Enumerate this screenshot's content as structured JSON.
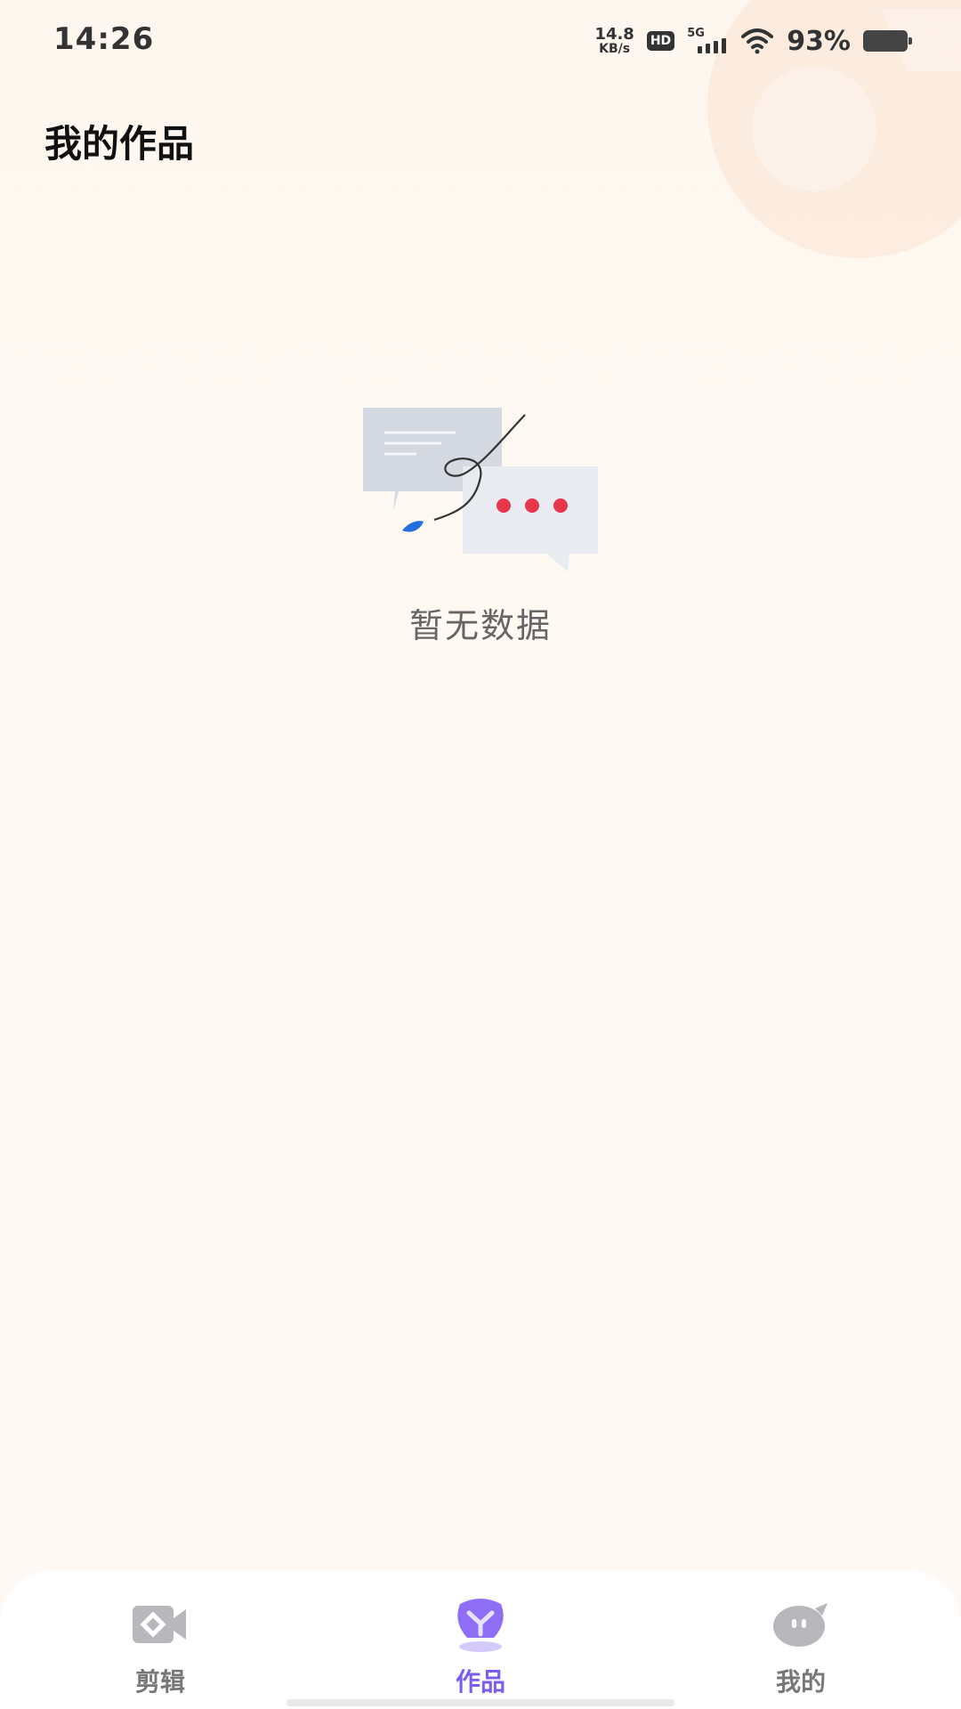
{
  "status_bar": {
    "time": "14:26",
    "net_speed_value": "14.8",
    "net_speed_unit": "KB/s",
    "hd_badge": "HD",
    "network_type": "5G",
    "battery_percent": "93%",
    "battery_level": 0.93
  },
  "header": {
    "title": "我的作品"
  },
  "empty_state": {
    "message": "暂无数据",
    "icon": "chat-bubbles-icon"
  },
  "bottom_nav": {
    "active_index": 1,
    "accent_color": "#7b5cf0",
    "items": [
      {
        "label": "剪辑",
        "icon": "video-camera-icon"
      },
      {
        "label": "作品",
        "icon": "works-icon"
      },
      {
        "label": "我的",
        "icon": "profile-icon"
      }
    ]
  }
}
